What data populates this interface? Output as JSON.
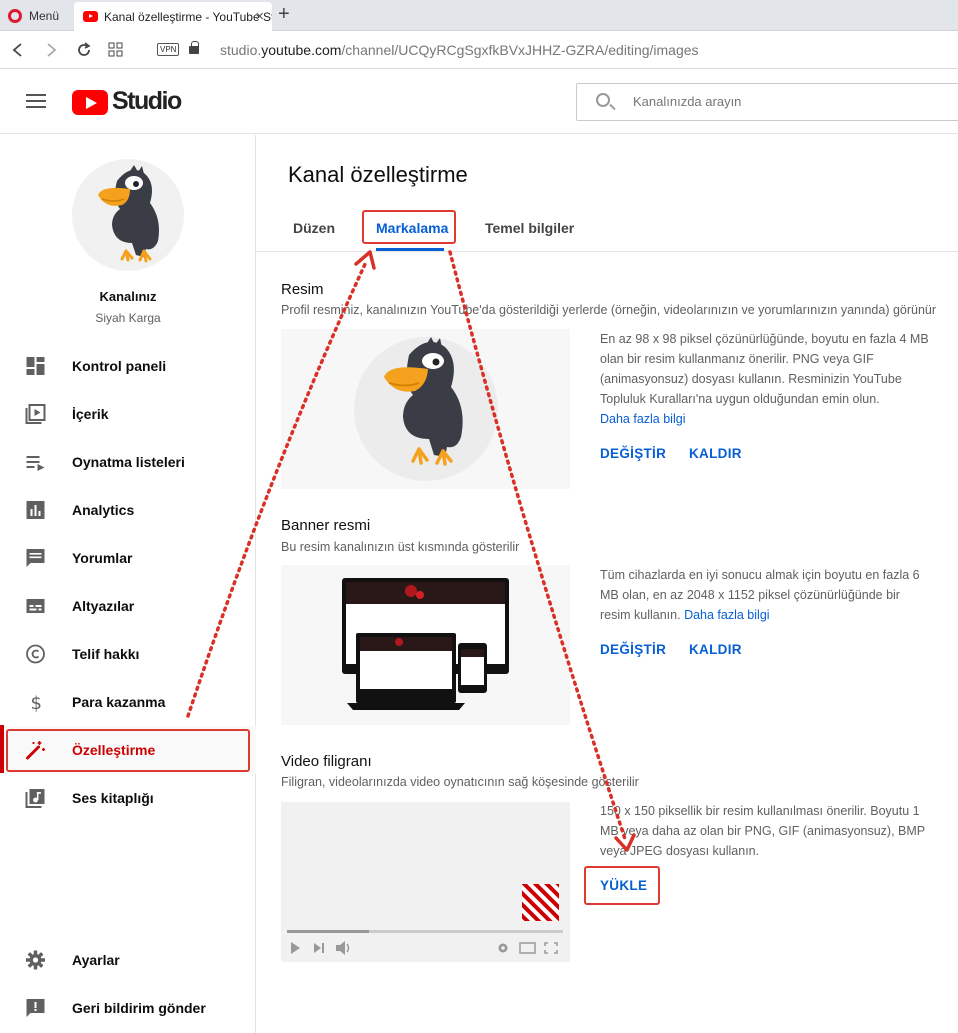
{
  "browser": {
    "menu_label": "Menü",
    "tab_title": "Kanal özelleştirme - YouTube Studio",
    "tab_close": "×",
    "new_tab": "+",
    "vpn_label": "VPN",
    "url_prefix": "studio.",
    "url_domain": "youtube.com",
    "url_path": "/channel/UCQyRCgSgxfkBVxJHHZ-GZRA/editing/images"
  },
  "header": {
    "logo_text": "Studio",
    "search_placeholder": "Kanalınızda arayın"
  },
  "channel": {
    "name": "Kanalınız",
    "subtitle": "Siyah Karga"
  },
  "sidebar": {
    "items": [
      {
        "label": "Kontrol paneli",
        "icon": "dashboard-icon"
      },
      {
        "label": "İçerik",
        "icon": "content-icon"
      },
      {
        "label": "Oynatma listeleri",
        "icon": "playlists-icon"
      },
      {
        "label": "Analytics",
        "icon": "analytics-icon"
      },
      {
        "label": "Yorumlar",
        "icon": "comments-icon"
      },
      {
        "label": "Altyazılar",
        "icon": "subtitles-icon"
      },
      {
        "label": "Telif hakkı",
        "icon": "copyright-icon"
      },
      {
        "label": "Para kazanma",
        "icon": "dollar-icon"
      },
      {
        "label": "Özelleştirme",
        "icon": "magic-wand-icon",
        "active": true
      },
      {
        "label": "Ses kitaplığı",
        "icon": "audio-library-icon"
      }
    ],
    "bottom_items": [
      {
        "label": "Ayarlar",
        "icon": "gear-icon"
      },
      {
        "label": "Geri bildirim gönder",
        "icon": "feedback-icon"
      }
    ]
  },
  "main": {
    "title": "Kanal özelleştirme",
    "tabs": [
      {
        "label": "Düzen"
      },
      {
        "label": "Markalama",
        "active": true
      },
      {
        "label": "Temel bilgiler"
      }
    ],
    "sections": {
      "picture": {
        "title": "Resim",
        "description": "Profil resminiz, kanalınızın YouTube'da gösterildiği yerlerde (örneğin, videolarınızın ve yorumlarınızın yanında) görünür",
        "info": "En az 98 x 98 piksel çözünürlüğünde, boyutu en fazla 4 MB olan bir resim kullanmanız önerilir. PNG veya GIF (animasyonsuz) dosyası kullanın. Resminizin YouTube Topluluk Kuralları'na uygun olduğundan emin olun.",
        "link": "Daha fazla bilgi",
        "change_label": "DEĞİŞTİR",
        "remove_label": "KALDIR"
      },
      "banner": {
        "title": "Banner resmi",
        "description": "Bu resim kanalınızın üst kısmında gösterilir",
        "info": "Tüm cihazlarda en iyi sonucu almak için boyutu en fazla 6 MB olan, en az 2048 x 1152 piksel çözünürlüğünde bir resim kullanın.",
        "link": "Daha fazla bilgi",
        "change_label": "DEĞİŞTİR",
        "remove_label": "KALDIR"
      },
      "watermark": {
        "title": "Video filigranı",
        "description": "Filigran, videolarınızda video oynatıcının sağ köşesinde gösterilir",
        "info": "150 x 150 piksellik bir resim kullanılması önerilir. Boyutu 1 MB veya daha az olan bir PNG, GIF (animasyonsuz), BMP veya JPEG dosyası kullanın.",
        "upload_label": "YÜKLE"
      }
    }
  },
  "colors": {
    "accent": "#065fd4",
    "brand_red": "#ff0000",
    "active_red": "#cc0000",
    "annotation_red": "#dd3b31"
  }
}
